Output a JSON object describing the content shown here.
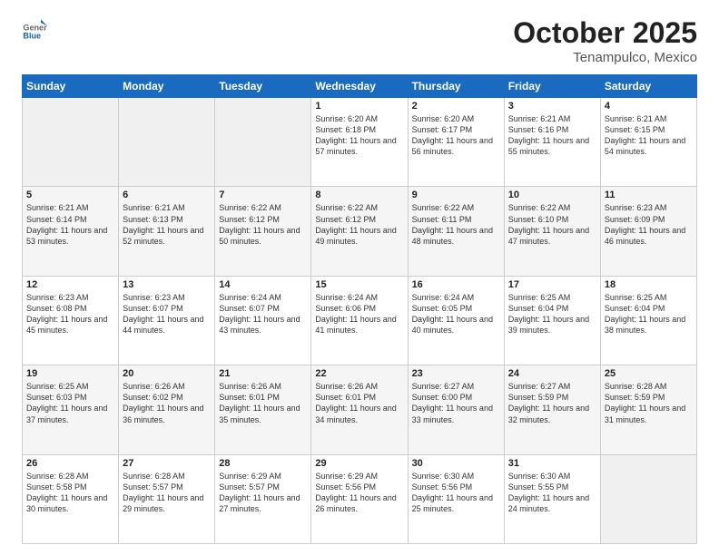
{
  "header": {
    "logo": {
      "general": "General",
      "blue": "Blue"
    },
    "title": "October 2025",
    "subtitle": "Tenampulco, Mexico"
  },
  "weekdays": [
    "Sunday",
    "Monday",
    "Tuesday",
    "Wednesday",
    "Thursday",
    "Friday",
    "Saturday"
  ],
  "weeks": [
    [
      {
        "day": "",
        "sunrise": "",
        "sunset": "",
        "daylight": "",
        "empty": true
      },
      {
        "day": "",
        "sunrise": "",
        "sunset": "",
        "daylight": "",
        "empty": true
      },
      {
        "day": "",
        "sunrise": "",
        "sunset": "",
        "daylight": "",
        "empty": true
      },
      {
        "day": "1",
        "sunrise": "Sunrise: 6:20 AM",
        "sunset": "Sunset: 6:18 PM",
        "daylight": "Daylight: 11 hours and 57 minutes."
      },
      {
        "day": "2",
        "sunrise": "Sunrise: 6:20 AM",
        "sunset": "Sunset: 6:17 PM",
        "daylight": "Daylight: 11 hours and 56 minutes."
      },
      {
        "day": "3",
        "sunrise": "Sunrise: 6:21 AM",
        "sunset": "Sunset: 6:16 PM",
        "daylight": "Daylight: 11 hours and 55 minutes."
      },
      {
        "day": "4",
        "sunrise": "Sunrise: 6:21 AM",
        "sunset": "Sunset: 6:15 PM",
        "daylight": "Daylight: 11 hours and 54 minutes."
      }
    ],
    [
      {
        "day": "5",
        "sunrise": "Sunrise: 6:21 AM",
        "sunset": "Sunset: 6:14 PM",
        "daylight": "Daylight: 11 hours and 53 minutes."
      },
      {
        "day": "6",
        "sunrise": "Sunrise: 6:21 AM",
        "sunset": "Sunset: 6:13 PM",
        "daylight": "Daylight: 11 hours and 52 minutes."
      },
      {
        "day": "7",
        "sunrise": "Sunrise: 6:22 AM",
        "sunset": "Sunset: 6:12 PM",
        "daylight": "Daylight: 11 hours and 50 minutes."
      },
      {
        "day": "8",
        "sunrise": "Sunrise: 6:22 AM",
        "sunset": "Sunset: 6:12 PM",
        "daylight": "Daylight: 11 hours and 49 minutes."
      },
      {
        "day": "9",
        "sunrise": "Sunrise: 6:22 AM",
        "sunset": "Sunset: 6:11 PM",
        "daylight": "Daylight: 11 hours and 48 minutes."
      },
      {
        "day": "10",
        "sunrise": "Sunrise: 6:22 AM",
        "sunset": "Sunset: 6:10 PM",
        "daylight": "Daylight: 11 hours and 47 minutes."
      },
      {
        "day": "11",
        "sunrise": "Sunrise: 6:23 AM",
        "sunset": "Sunset: 6:09 PM",
        "daylight": "Daylight: 11 hours and 46 minutes."
      }
    ],
    [
      {
        "day": "12",
        "sunrise": "Sunrise: 6:23 AM",
        "sunset": "Sunset: 6:08 PM",
        "daylight": "Daylight: 11 hours and 45 minutes."
      },
      {
        "day": "13",
        "sunrise": "Sunrise: 6:23 AM",
        "sunset": "Sunset: 6:07 PM",
        "daylight": "Daylight: 11 hours and 44 minutes."
      },
      {
        "day": "14",
        "sunrise": "Sunrise: 6:24 AM",
        "sunset": "Sunset: 6:07 PM",
        "daylight": "Daylight: 11 hours and 43 minutes."
      },
      {
        "day": "15",
        "sunrise": "Sunrise: 6:24 AM",
        "sunset": "Sunset: 6:06 PM",
        "daylight": "Daylight: 11 hours and 41 minutes."
      },
      {
        "day": "16",
        "sunrise": "Sunrise: 6:24 AM",
        "sunset": "Sunset: 6:05 PM",
        "daylight": "Daylight: 11 hours and 40 minutes."
      },
      {
        "day": "17",
        "sunrise": "Sunrise: 6:25 AM",
        "sunset": "Sunset: 6:04 PM",
        "daylight": "Daylight: 11 hours and 39 minutes."
      },
      {
        "day": "18",
        "sunrise": "Sunrise: 6:25 AM",
        "sunset": "Sunset: 6:04 PM",
        "daylight": "Daylight: 11 hours and 38 minutes."
      }
    ],
    [
      {
        "day": "19",
        "sunrise": "Sunrise: 6:25 AM",
        "sunset": "Sunset: 6:03 PM",
        "daylight": "Daylight: 11 hours and 37 minutes."
      },
      {
        "day": "20",
        "sunrise": "Sunrise: 6:26 AM",
        "sunset": "Sunset: 6:02 PM",
        "daylight": "Daylight: 11 hours and 36 minutes."
      },
      {
        "day": "21",
        "sunrise": "Sunrise: 6:26 AM",
        "sunset": "Sunset: 6:01 PM",
        "daylight": "Daylight: 11 hours and 35 minutes."
      },
      {
        "day": "22",
        "sunrise": "Sunrise: 6:26 AM",
        "sunset": "Sunset: 6:01 PM",
        "daylight": "Daylight: 11 hours and 34 minutes."
      },
      {
        "day": "23",
        "sunrise": "Sunrise: 6:27 AM",
        "sunset": "Sunset: 6:00 PM",
        "daylight": "Daylight: 11 hours and 33 minutes."
      },
      {
        "day": "24",
        "sunrise": "Sunrise: 6:27 AM",
        "sunset": "Sunset: 5:59 PM",
        "daylight": "Daylight: 11 hours and 32 minutes."
      },
      {
        "day": "25",
        "sunrise": "Sunrise: 6:28 AM",
        "sunset": "Sunset: 5:59 PM",
        "daylight": "Daylight: 11 hours and 31 minutes."
      }
    ],
    [
      {
        "day": "26",
        "sunrise": "Sunrise: 6:28 AM",
        "sunset": "Sunset: 5:58 PM",
        "daylight": "Daylight: 11 hours and 30 minutes."
      },
      {
        "day": "27",
        "sunrise": "Sunrise: 6:28 AM",
        "sunset": "Sunset: 5:57 PM",
        "daylight": "Daylight: 11 hours and 29 minutes."
      },
      {
        "day": "28",
        "sunrise": "Sunrise: 6:29 AM",
        "sunset": "Sunset: 5:57 PM",
        "daylight": "Daylight: 11 hours and 27 minutes."
      },
      {
        "day": "29",
        "sunrise": "Sunrise: 6:29 AM",
        "sunset": "Sunset: 5:56 PM",
        "daylight": "Daylight: 11 hours and 26 minutes."
      },
      {
        "day": "30",
        "sunrise": "Sunrise: 6:30 AM",
        "sunset": "Sunset: 5:56 PM",
        "daylight": "Daylight: 11 hours and 25 minutes."
      },
      {
        "day": "31",
        "sunrise": "Sunrise: 6:30 AM",
        "sunset": "Sunset: 5:55 PM",
        "daylight": "Daylight: 11 hours and 24 minutes."
      },
      {
        "day": "",
        "sunrise": "",
        "sunset": "",
        "daylight": "",
        "empty": true
      }
    ]
  ]
}
